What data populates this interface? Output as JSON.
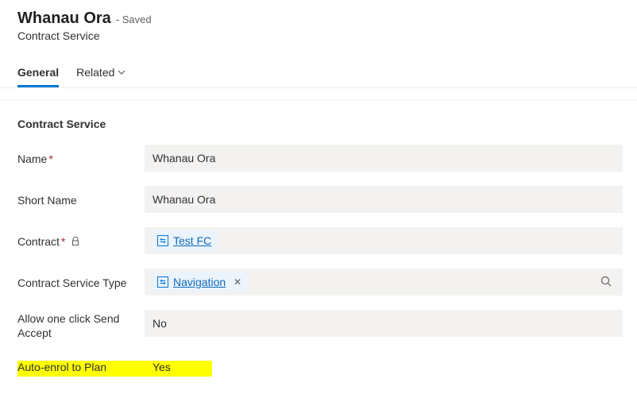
{
  "header": {
    "title": "Whanau Ora",
    "saved": "- Saved",
    "subtitle": "Contract Service"
  },
  "tabs": {
    "general": "General",
    "related": "Related"
  },
  "section": {
    "heading": "Contract Service"
  },
  "fields": {
    "name": {
      "label": "Name",
      "value": "Whanau Ora"
    },
    "short_name": {
      "label": "Short Name",
      "value": "Whanau Ora"
    },
    "contract": {
      "label": "Contract",
      "value": "Test FC"
    },
    "service_type": {
      "label": "Contract Service Type",
      "value": "Navigation"
    },
    "allow_one_click": {
      "label": "Allow one click Send Accept",
      "value": "No"
    },
    "auto_enrol": {
      "label": "Auto-enrol to Plan",
      "value": "Yes"
    }
  },
  "icons": {
    "remove": "✕",
    "search": "⌕",
    "lock": "🔒",
    "link": "⇔"
  }
}
